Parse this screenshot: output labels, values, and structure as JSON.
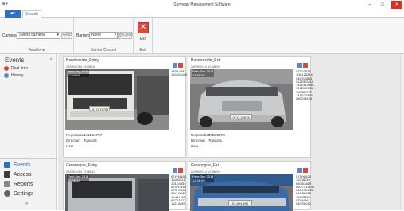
{
  "window": {
    "title": "Surveian Management Software",
    "quick_access": "■ ▾",
    "minimize": "–",
    "maximize": "□",
    "close": "✕"
  },
  "ribbon": {
    "file_tab": "",
    "tabs": [
      "Search"
    ],
    "groups": {
      "realtime": {
        "label": "Real time",
        "cameras_label": "Cameras",
        "camera_select": "Select camera",
        "add_label": "Add"
      },
      "barrier": {
        "label": "Barrier Control",
        "barriers_label": "Barriers",
        "barrier_select": "None",
        "open_label": "Open"
      },
      "exit": {
        "label": "Exit",
        "button": "Exit"
      }
    }
  },
  "sidebar": {
    "title": "Events",
    "collapse": "<",
    "items": [
      {
        "label": "Real time",
        "icon": "realtime-icon",
        "color": "#d9483b"
      },
      {
        "label": "History",
        "icon": "history-icon",
        "color": "#5c88c9"
      }
    ],
    "nav": [
      {
        "label": "Events",
        "icon": "events-icon",
        "color": "#2a74c2",
        "active": true
      },
      {
        "label": "Access",
        "icon": "access-icon",
        "color": "#3a3a3a",
        "active": false
      },
      {
        "label": "Reports",
        "icon": "reports-icon",
        "color": "#888888",
        "active": false
      },
      {
        "label": "Settings",
        "icon": "settings-icon",
        "color": "#666666",
        "active": false
      }
    ],
    "more": "˅"
  },
  "cards": [
    {
      "name": "Bandonside_Entry",
      "time": "28/09/2014 10:48:08",
      "ocr": [
        "Refs:Sep 2014",
        "12:48:08"
      ],
      "plate": "141 D 19797",
      "codes": [
        "14D14797",
        "1S1123440"
      ],
      "registration": "141D14797",
      "direction": "Towards",
      "user": ""
    },
    {
      "name": "Bandonside_Exit",
      "time": "28/09/2014 12:48:53",
      "ocr": [
        "Refs:Sep 2014",
        "12:48:53"
      ],
      "plate": "07-D-23978",
      "codes": [
        "07D23978",
        "1D0125244",
        "04D374811",
        "0125303611",
        "141D110946",
        "12120 2395",
        "1S1129727",
        "141D23395",
        "080213425"
      ],
      "registration": "07D23978",
      "direction": "Towards",
      "user": ""
    },
    {
      "name": "Greenogue_Entry",
      "time": "22/09/2014 12:36:43",
      "ocr": [
        "Refs:Sep 2014",
        "12:36:43"
      ],
      "plate": "",
      "codes": [
        "07YH3188",
        "111D2611",
        "101D4954",
        "07SH7166",
        "07SH7682",
        "09YH1027",
        "11-ZLH49",
        "07C11671",
        "11ZL4489"
      ],
      "registration": "",
      "direction": "",
      "user": ""
    },
    {
      "name": "Greenogue_Exit",
      "time": "22/09/2014 12:36:09",
      "ocr": [
        "Refs:Sep 2014",
        "12:36:09"
      ],
      "plate": "07-WH-991",
      "codes": [
        "07SH6826",
        "111D8010",
        "06G87468",
        "06G7313141",
        "06D4751S3",
        "04CS8022",
        "111D6336",
        "07WH991",
        "04CS8012"
      ],
      "registration": "",
      "direction": "",
      "user": ""
    }
  ],
  "labels": {
    "registration": "Registration",
    "direction": "Direction",
    "user": "User"
  }
}
